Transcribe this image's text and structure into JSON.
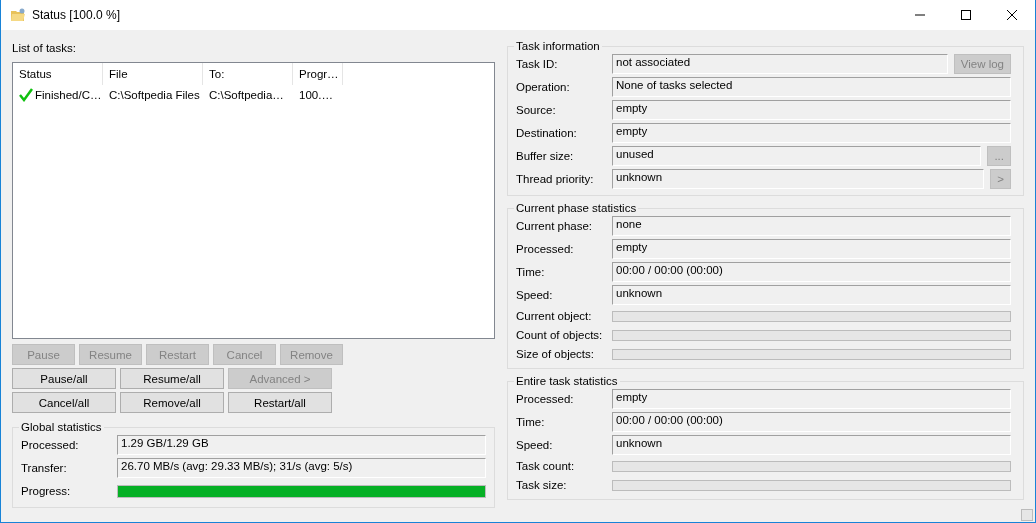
{
  "window": {
    "title": "Status [100.0 %]"
  },
  "tasks": {
    "label": "List of tasks:",
    "columns": [
      "Status",
      "File",
      "To:",
      "Progr…"
    ],
    "rows": [
      {
        "status": "Finished/C…",
        "file": "C:\\Softpedia Files",
        "to": "C:\\Softpedia…",
        "progress": "100.…"
      }
    ]
  },
  "button_rows": [
    [
      {
        "label": "Pause",
        "disabled": true
      },
      {
        "label": "Resume",
        "disabled": true
      },
      {
        "label": "Restart",
        "disabled": true
      },
      {
        "label": "Cancel",
        "disabled": true
      },
      {
        "label": "Remove",
        "disabled": true
      }
    ],
    [
      {
        "label": "Pause/all",
        "disabled": false
      },
      {
        "label": "Resume/all",
        "disabled": false
      },
      {
        "label": "Advanced >",
        "disabled": true
      }
    ],
    [
      {
        "label": "Cancel/all",
        "disabled": false
      },
      {
        "label": "Remove/all",
        "disabled": false
      },
      {
        "label": "Restart/all",
        "disabled": false
      }
    ]
  ],
  "global_statistics": {
    "title": "Global statistics",
    "rows": [
      {
        "kind": "field",
        "label": "Processed:",
        "value": "1.29 GB/1.29 GB"
      },
      {
        "kind": "field",
        "label": "Transfer:",
        "value": "26.70 MB/s (avg: 29.33 MB/s); 31/s (avg: 5/s)"
      },
      {
        "kind": "progress",
        "label": "Progress:",
        "level": 1
      }
    ]
  },
  "task_information": {
    "title": "Task information",
    "rows": [
      {
        "kind": "field",
        "label": "Task ID:",
        "value": "not associated",
        "button": {
          "label": "View log",
          "disabled": true
        }
      },
      {
        "kind": "field",
        "label": "Operation:",
        "value": "None of tasks selected"
      },
      {
        "kind": "field",
        "label": "Source:",
        "value": "empty"
      },
      {
        "kind": "field",
        "label": "Destination:",
        "value": "empty"
      },
      {
        "kind": "field",
        "label": "Buffer size:",
        "value": "unused",
        "button": {
          "label": "...",
          "disabled": true
        }
      },
      {
        "kind": "field",
        "label": "Thread priority:",
        "value": "unknown",
        "button": {
          "label": ">",
          "disabled": true
        }
      }
    ]
  },
  "current_phase_statistics": {
    "title": "Current phase statistics",
    "rows": [
      {
        "kind": "field",
        "label": "Current phase:",
        "value": "none"
      },
      {
        "kind": "field",
        "label": "Processed:",
        "value": "empty"
      },
      {
        "kind": "field",
        "label": "Time:",
        "value": "00:00 / 00:00 (00:00)"
      },
      {
        "kind": "field",
        "label": "Speed:",
        "value": "unknown"
      },
      {
        "kind": "bar",
        "label": "Current object:",
        "level": 0
      },
      {
        "kind": "bar",
        "label": "Count of objects:",
        "level": 0
      },
      {
        "kind": "bar",
        "label": "Size of objects:",
        "level": 0
      }
    ]
  },
  "entire_task_statistics": {
    "title": "Entire task statistics",
    "rows": [
      {
        "kind": "field",
        "label": "Processed:",
        "value": "empty"
      },
      {
        "kind": "field",
        "label": "Time:",
        "value": "00:00 / 00:00 (00:00)"
      },
      {
        "kind": "field",
        "label": "Speed:",
        "value": "unknown"
      },
      {
        "kind": "bar",
        "label": "Task count:",
        "level": 0
      },
      {
        "kind": "bar",
        "label": "Task size:",
        "level": 0
      }
    ]
  }
}
